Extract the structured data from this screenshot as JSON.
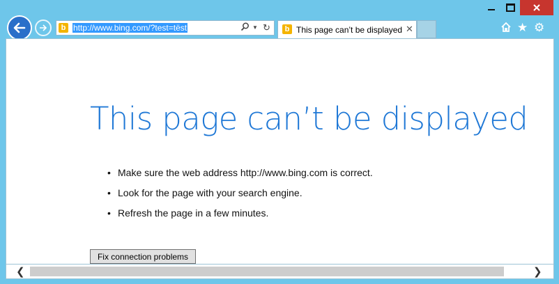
{
  "window": {
    "accent": "#6ec6ea",
    "controls": {
      "minimize": "minimize-icon",
      "maximize": "maximize-icon",
      "close": "close-icon"
    }
  },
  "nav": {
    "back_icon": "back-arrow-icon",
    "forward_icon": "forward-arrow-icon"
  },
  "address_bar": {
    "url": "http://www.bing.com/?test=tëst",
    "favicon": "b",
    "icons": [
      "search-icon",
      "dropdown-icon",
      "refresh-icon"
    ]
  },
  "tab": {
    "title": "This page can’t be displayed",
    "favicon": "b"
  },
  "toolbar": {
    "icons": [
      "home-icon",
      "favorites-icon",
      "settings-icon"
    ]
  },
  "page": {
    "headline": "This page can’t be displayed",
    "tips": [
      "Make sure the web address http://www.bing.com is correct.",
      "Look for the page with your search engine.",
      "Refresh the page in a few minutes."
    ],
    "fix_button": "Fix connection problems",
    "headline_color": "#1f78d6"
  }
}
